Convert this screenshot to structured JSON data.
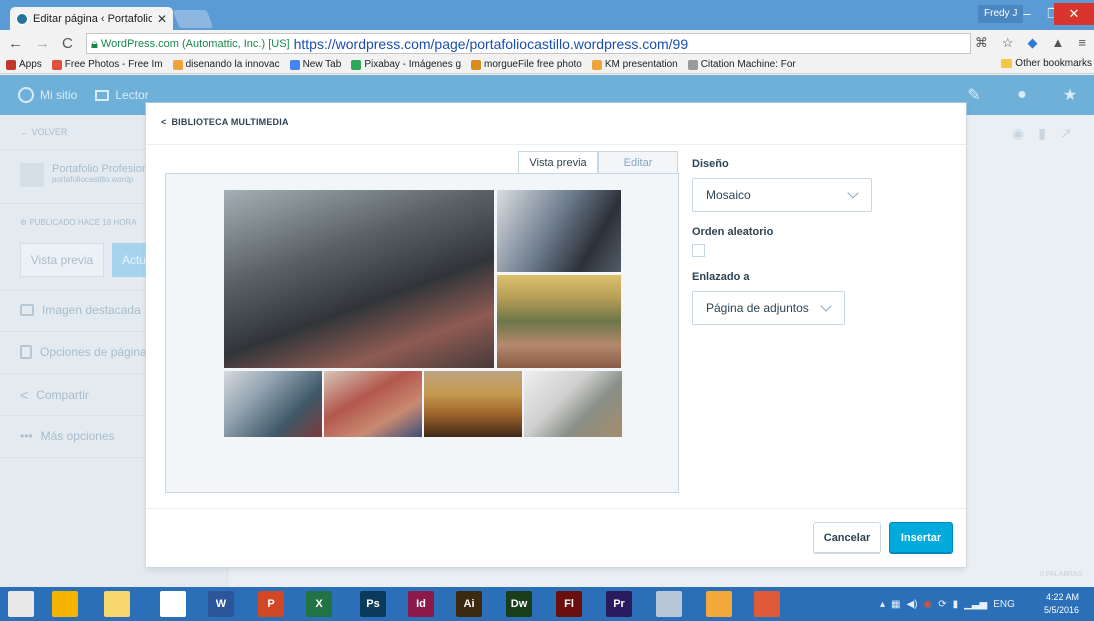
{
  "browser": {
    "tab_title": "Editar página ‹ Portafolio",
    "user_badge": "Fredy J",
    "ssl_label": "WordPress.com (Automattic, Inc.) [US]",
    "url": "https://wordpress.com/page/portafoliocastillo.wordpress.com/99",
    "bookmarks": [
      {
        "label": "Apps",
        "color": "#c0392b"
      },
      {
        "label": "Free Photos - Free Im",
        "color": "#e2503a"
      },
      {
        "label": "disenando la innovac",
        "color": "#f0a23b"
      },
      {
        "label": "New Tab",
        "color": "#4285f4"
      },
      {
        "label": "Pixabay - Imágenes g",
        "color": "#2ca85b"
      },
      {
        "label": "morgueFile free photo",
        "color": "#d98c1b"
      },
      {
        "label": "KM presentation",
        "color": "#f0a23b"
      },
      {
        "label": "Citation Machine: For",
        "color": "#9a9a9a"
      }
    ],
    "other_bookmarks": "Other bookmarks"
  },
  "masterbar": {
    "my_site": "Mi sitio",
    "reader": "Lector"
  },
  "sidebar": {
    "back": "← VOLVER",
    "site_title": "Portafolio Profesion",
    "site_url": "portafoliocastillo.wordp",
    "published": "PUBLICADO HACE 18 HORA",
    "preview_button": "Vista previa",
    "update_button": "Actu",
    "items": [
      {
        "label": "Imagen destacada"
      },
      {
        "label": "Opciones de página"
      },
      {
        "label": "Compartir"
      },
      {
        "label": "Más opciones"
      }
    ]
  },
  "modal": {
    "back_link": "BIBLIOTECA MULTIMEDIA",
    "tabs": [
      {
        "label": "Vista previa",
        "active": true
      },
      {
        "label": "Editar",
        "active": false
      }
    ],
    "settings": {
      "layout_label": "Diseño",
      "layout_value": "Mosaico",
      "random_label": "Orden aleatorio",
      "random_checked": false,
      "link_label": "Enlazado a",
      "link_value": "Página de adjuntos"
    },
    "cancel_button": "Cancelar",
    "insert_button": "Insertar"
  },
  "word_count": "0 PALABRAS",
  "taskbar": {
    "apps": [
      {
        "label": "",
        "color": "#e8e8e8",
        "name": "windows-start-icon"
      },
      {
        "label": "",
        "color": "#f4b400",
        "name": "chrome-icon"
      },
      {
        "label": "",
        "color": "#f5d76e",
        "name": "file-explorer-icon"
      },
      {
        "label": "",
        "color": "#ffffff",
        "name": "home-icon"
      },
      {
        "label": "W",
        "color": "#2b579a",
        "name": "word-icon"
      },
      {
        "label": "P",
        "color": "#d24726",
        "name": "powerpoint-icon"
      },
      {
        "label": "X",
        "color": "#217346",
        "name": "excel-icon"
      },
      {
        "label": "Ps",
        "color": "#0b3a5a",
        "name": "photoshop-icon"
      },
      {
        "label": "Id",
        "color": "#8b1a4a",
        "name": "indesign-icon"
      },
      {
        "label": "Ai",
        "color": "#3b2a10",
        "name": "illustrator-icon"
      },
      {
        "label": "Dw",
        "color": "#1a3d1a",
        "name": "dreamweaver-icon"
      },
      {
        "label": "Fl",
        "color": "#6b0e0e",
        "name": "flash-icon"
      },
      {
        "label": "Pr",
        "color": "#2a1a5e",
        "name": "premiere-icon"
      },
      {
        "label": "",
        "color": "#b8c7d6",
        "name": "calculator-icon"
      },
      {
        "label": "",
        "color": "#f2a93b",
        "name": "media-player-icon"
      },
      {
        "label": "",
        "color": "#e05a3a",
        "name": "maps-icon"
      }
    ],
    "language": "ENG",
    "time": "4:22 AM",
    "date": "5/5/2016"
  }
}
